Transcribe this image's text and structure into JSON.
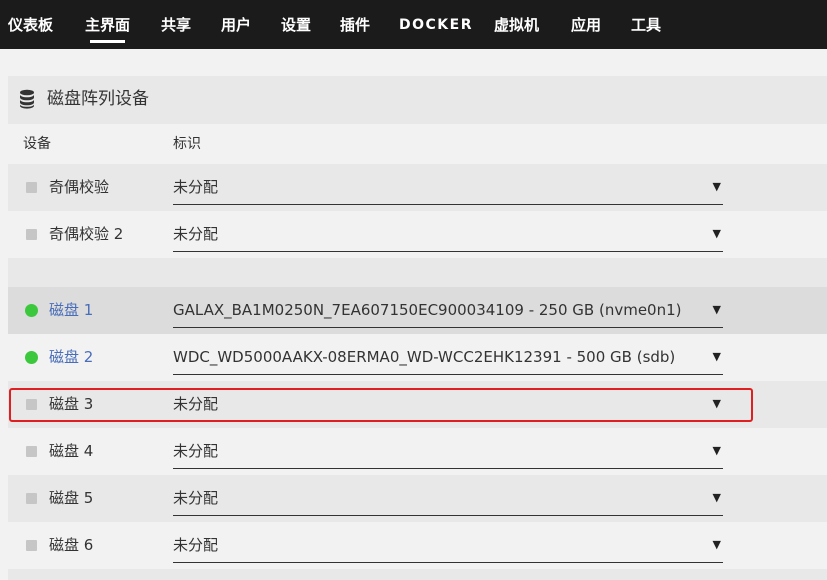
{
  "nav": [
    {
      "label": "仪表板"
    },
    {
      "label": "主界面"
    },
    {
      "label": "共享"
    },
    {
      "label": "用户"
    },
    {
      "label": "设置"
    },
    {
      "label": "插件"
    },
    {
      "label": "DOCKER"
    },
    {
      "label": "虚拟机"
    },
    {
      "label": "应用"
    },
    {
      "label": "工具"
    }
  ],
  "panel": {
    "icon": "database-icon",
    "title": "磁盘阵列设备",
    "col_device": "设备",
    "col_id": "标识"
  },
  "rows": [
    {
      "label": "奇偶校验",
      "value": "未分配",
      "status": "unassigned"
    },
    {
      "label": "奇偶校验 2",
      "value": "未分配",
      "status": "unassigned"
    },
    {
      "label": "磁盘 1",
      "value": "GALAX_BA1M0250N_7EA607150EC900034109 - 250 GB (nvme0n1)",
      "status": "online"
    },
    {
      "label": "磁盘 2",
      "value": "WDC_WD5000AAKX-08ERMA0_WD-WCC2EHK12391 - 500 GB (sdb)",
      "status": "online"
    },
    {
      "label": "磁盘 3",
      "value": "未分配",
      "status": "unassigned"
    },
    {
      "label": "磁盘 4",
      "value": "未分配",
      "status": "unassigned"
    },
    {
      "label": "磁盘 5",
      "value": "未分配",
      "status": "unassigned"
    },
    {
      "label": "磁盘 6",
      "value": "未分配",
      "status": "unassigned"
    }
  ],
  "colors": {
    "nav_bg": "#1c1b1b",
    "online": "#3cc83c",
    "unassigned": "#c6c6c6",
    "link": "#486dba",
    "highlight_border": "#e02020"
  },
  "caret_glyph": "▼"
}
